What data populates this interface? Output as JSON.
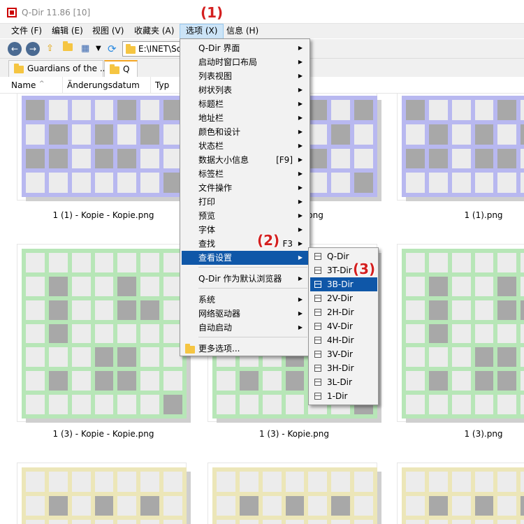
{
  "window": {
    "title": "Q-Dir 11.86 [10]"
  },
  "menubar": {
    "items": [
      {
        "label": "文件 (F)"
      },
      {
        "label": "编辑 (E)"
      },
      {
        "label": "视图 (V)"
      },
      {
        "label": "收藏夹 (A)"
      },
      {
        "label": "选项 (X)"
      },
      {
        "label": "信息 (H)"
      }
    ]
  },
  "toolbar": {
    "address": "E:\\INET\\So"
  },
  "tabs": [
    {
      "label": "Guardians of the ..."
    },
    {
      "label": "Q"
    }
  ],
  "columns": [
    {
      "label": "Name"
    },
    {
      "label": "Änderungsdatum"
    },
    {
      "label": "Typ"
    }
  ],
  "thumbnails": [
    {
      "caption": "1 (1) - Kopie - Kopie.png",
      "color": "#b8b8f0"
    },
    {
      "caption": "png",
      "color": "#b8b8f0"
    },
    {
      "caption": "1 (1).png",
      "color": "#b8b8f0"
    },
    {
      "caption": "1 (3) - Kopie - Kopie.png",
      "color": "#b7e6b7"
    },
    {
      "caption": "1 (3) - Kopie.png",
      "color": "#b7e6b7"
    },
    {
      "caption": "1 (3).png",
      "color": "#b7e6b7"
    },
    {
      "caption": "",
      "color": "#ece6b8"
    },
    {
      "caption": "",
      "color": "#ece6b8"
    },
    {
      "caption": "",
      "color": "#ece6b8"
    }
  ],
  "options_menu": {
    "items": [
      {
        "label": "Q-Dir 界面",
        "submenu": true
      },
      {
        "label": "启动时窗口布局",
        "submenu": true
      },
      {
        "label": "列表视图",
        "submenu": true
      },
      {
        "label": "树状列表",
        "submenu": true
      },
      {
        "label": "标题栏",
        "submenu": true
      },
      {
        "label": "地址栏",
        "submenu": true
      },
      {
        "label": "颜色和设计",
        "submenu": true
      },
      {
        "label": "状态栏",
        "submenu": true
      },
      {
        "label": "数据大小信息",
        "shortcut": "[F9]",
        "submenu": true
      },
      {
        "label": "标签栏",
        "submenu": true
      },
      {
        "label": "文件操作",
        "submenu": true
      },
      {
        "label": "打印",
        "submenu": true
      },
      {
        "label": "预览",
        "submenu": true
      },
      {
        "label": "字体",
        "submenu": true
      },
      {
        "label": "查找",
        "shortcut": "F3",
        "submenu": true
      },
      {
        "label": "查看设置",
        "submenu": true,
        "selected": true
      },
      {
        "label": "Q-Dir 作为默认浏览器",
        "submenu": true
      },
      {
        "label": "系统",
        "submenu": true
      },
      {
        "label": "网络驱动器",
        "submenu": true
      },
      {
        "label": "自动启动",
        "submenu": true
      },
      {
        "label": "更多选项..."
      }
    ]
  },
  "view_submenu": {
    "items": [
      {
        "label": "Q-Dir"
      },
      {
        "label": "3T-Dir"
      },
      {
        "label": "3B-Dir",
        "selected": true
      },
      {
        "label": "2V-Dir"
      },
      {
        "label": "2H-Dir"
      },
      {
        "label": "4V-Dir"
      },
      {
        "label": "4H-Dir"
      },
      {
        "label": "3V-Dir"
      },
      {
        "label": "3H-Dir"
      },
      {
        "label": "3L-Dir"
      },
      {
        "label": "1-Dir"
      }
    ]
  },
  "callouts": [
    {
      "label": "(1)"
    },
    {
      "label": "(2)"
    },
    {
      "label": "(3)"
    }
  ],
  "colors": {
    "menu_highlight": "#0f57a8",
    "callout": "#d42020",
    "tab_accent": "#f5a623"
  }
}
